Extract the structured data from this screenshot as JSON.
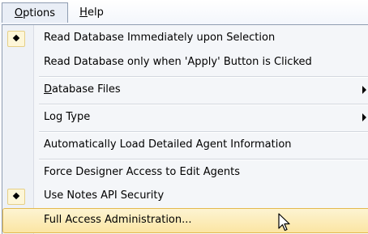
{
  "menubar": {
    "options": {
      "underline": "O",
      "rest": "ptions"
    },
    "help": {
      "underline": "H",
      "rest": "elp"
    }
  },
  "menu": {
    "items": [
      {
        "label": "Read Database Immediately upon Selection",
        "checked": true
      },
      {
        "label": "Read Database only when 'Apply' Button is Clicked",
        "checked": false
      },
      {
        "label_underline": "D",
        "label_rest": "atabase Files",
        "submenu": true
      },
      {
        "label": "Log Type",
        "submenu": true
      },
      {
        "label": "Automatically Load Detailed Agent Information"
      },
      {
        "label": "Force Designer Access to Edit Agents"
      },
      {
        "label": "Use Notes API Security",
        "checked": true
      },
      {
        "label": "Full Access Administration...",
        "highlighted": true
      }
    ]
  },
  "colors": {
    "highlight_top": "#fdf4d2",
    "highlight_bottom": "#fbe5a3",
    "highlight_border": "#e3b94f",
    "menu_border": "#8f9db1"
  },
  "cursor": {
    "icon": "arrow-pointer-icon"
  }
}
